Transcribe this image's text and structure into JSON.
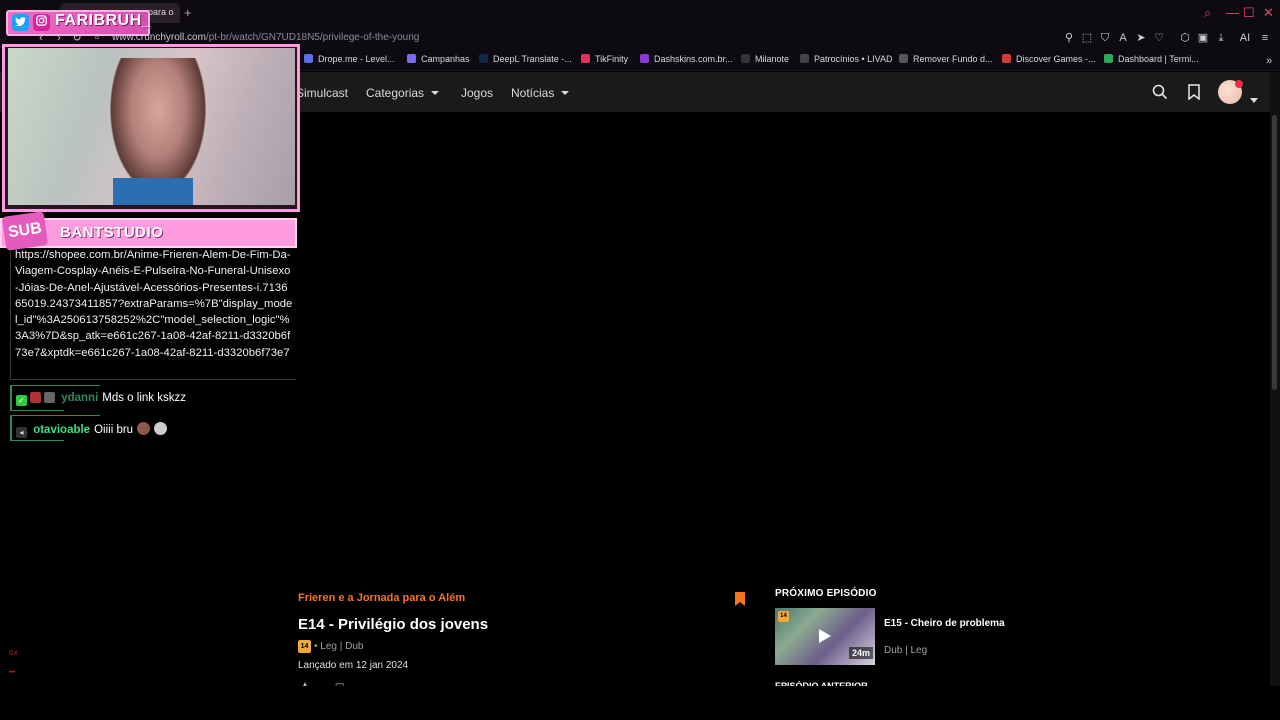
{
  "browser": {
    "tab_label": "para o",
    "tab_new": "+",
    "url_host": "www.crunchyroll.com",
    "url_path": "/pt-br/watch/GN7UD18N5/privilege-of-the-young",
    "bookmarks": [
      {
        "label": "Drope.me - Level...",
        "color": "#5b6ee8"
      },
      {
        "label": "Campanhas",
        "color": "#7a6af0"
      },
      {
        "label": "DeepL Translate -...",
        "color": "#0f2b46"
      },
      {
        "label": "TikFinity",
        "color": "#e0325a"
      },
      {
        "label": "Dashskins.com.br...",
        "color": "#8a3ad6"
      },
      {
        "label": "Milanote",
        "color": "#333333"
      },
      {
        "label": "Patrocínios • LIVAD",
        "color": "#444444"
      },
      {
        "label": "Remover Fundo d...",
        "color": "#555555"
      },
      {
        "label": "Discover Games -...",
        "color": "#d23b3b"
      },
      {
        "label": "Dashboard | Termi...",
        "color": "#2ea65c"
      }
    ],
    "toolbar_ai_label": "AI"
  },
  "header": {
    "nav": [
      {
        "label": "Simulcast",
        "has_caret": false
      },
      {
        "label": "Categorias",
        "has_caret": true
      },
      {
        "label": "Jogos",
        "has_caret": false
      },
      {
        "label": "Notícias",
        "has_caret": true
      }
    ]
  },
  "episode": {
    "series": "Frieren e a Jornada para o Além",
    "title": "E14 - Privilégio dos jovens",
    "rating": "14",
    "langs": "• Leg | Dub",
    "released": "Lançado em 12 jan 2024"
  },
  "next": {
    "label": "PRÓXIMO EPISÓDIO",
    "title": "E15 - Cheiro de problema",
    "langs": "Dub | Leg",
    "duration": "24m",
    "rating": "14"
  },
  "prev": {
    "label": "EPISÓDIO ANTERIOR"
  },
  "overlay": {
    "social_name": "FARIBRUH_",
    "sub_tag": "SUB",
    "sub_name": "BANTSTUDIO",
    "chat_link": "https://shopee.com.br/Anime-Frieren-Alem-De-Fim-Da-Viagem-Cosplay-Anéis-E-Pulseira-No-Funeral-Unisexo-Jóias-De-Anel-Ajustável-Acessórios-Presentes-i.713665019.24373411857?extraParams=%7B\"display_model_id\"%3A250613758252%2C\"model_selection_logic\"%3A3%7D&sp_atk=e661c267-1a08-42af-8211-d3320b6f73e7&xptdk=e661c267-1a08-42af-8211-d3320b6f73e7",
    "messages": [
      {
        "user": "ydanni",
        "user_color": "#2e8b57",
        "text": "Mds o link kskzz"
      },
      {
        "user": "otavioable",
        "user_color": "#3ddc84",
        "text": "Oiiii bru"
      }
    ]
  }
}
